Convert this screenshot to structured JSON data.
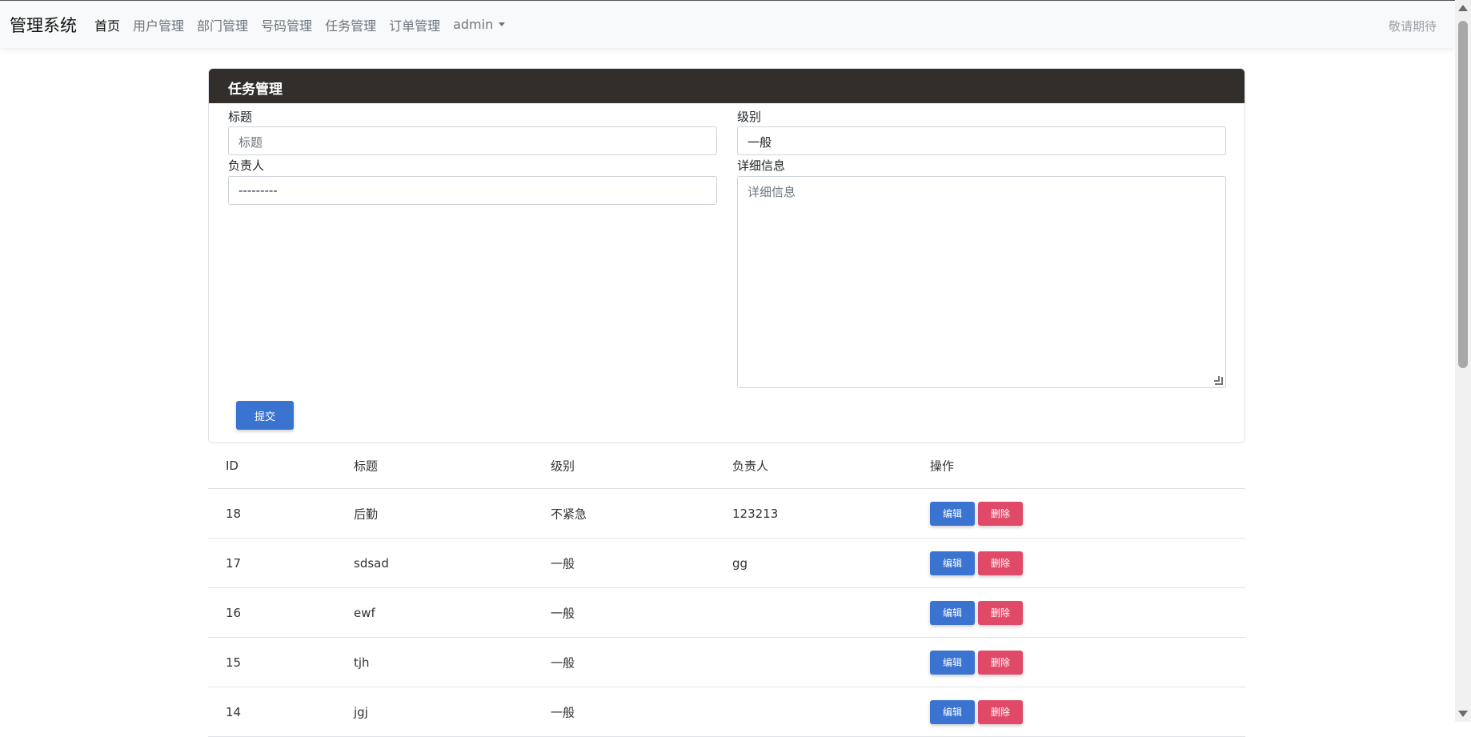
{
  "nav": {
    "brand": "管理系统",
    "items": [
      "首页",
      "用户管理",
      "部门管理",
      "号码管理",
      "任务管理",
      "订单管理"
    ],
    "user": "admin",
    "right": "敬请期待"
  },
  "panel": {
    "title": "任务管理",
    "fields": {
      "title_label": "标题",
      "title_placeholder": "标题",
      "level_label": "级别",
      "level_value": "一般",
      "owner_label": "负责人",
      "owner_value": "---------",
      "detail_label": "详细信息",
      "detail_placeholder": "详细信息"
    },
    "submit": "提交"
  },
  "table": {
    "headers": [
      "ID",
      "标题",
      "级别",
      "负责人",
      "操作"
    ],
    "rows": [
      {
        "id": "18",
        "title": "后勤",
        "level": "不紧急",
        "owner": "123213"
      },
      {
        "id": "17",
        "title": "sdsad",
        "level": "一般",
        "owner": "gg"
      },
      {
        "id": "16",
        "title": "ewf",
        "level": "一般",
        "owner": ""
      },
      {
        "id": "15",
        "title": "tjh",
        "level": "一般",
        "owner": ""
      },
      {
        "id": "14",
        "title": "jgj",
        "level": "一般",
        "owner": ""
      }
    ],
    "edit_label": "编辑",
    "delete_label": "删除"
  },
  "colors": {
    "header_bg": "#322e2c",
    "primary": "#3b73d1",
    "danger": "#e04a68"
  }
}
